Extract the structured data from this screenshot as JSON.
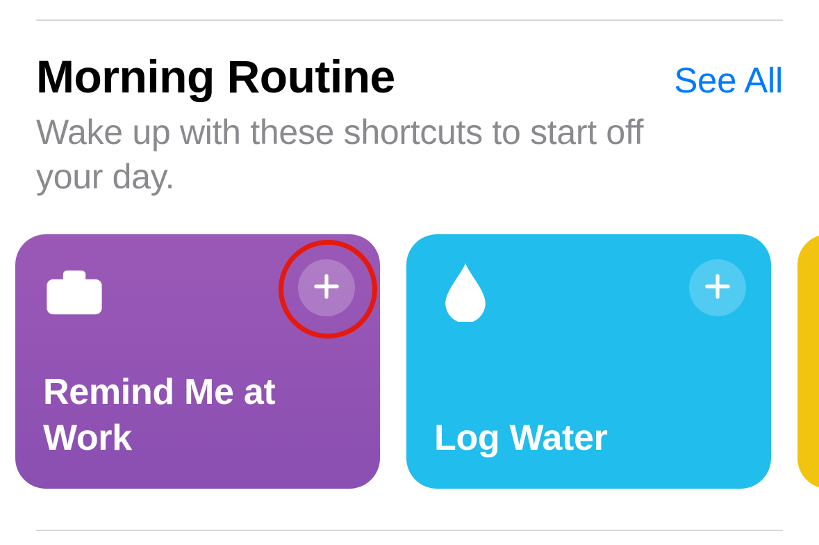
{
  "section": {
    "title": "Morning Routine",
    "subtitle": "Wake up with these shortcuts to start off your day.",
    "see_all": "See All"
  },
  "cards": [
    {
      "title": "Remind Me at Work",
      "icon": "briefcase-icon",
      "color": "purple"
    },
    {
      "title": "Log Water",
      "icon": "water-drop-icon",
      "color": "blue"
    },
    {
      "title": "",
      "icon": "",
      "color": "yellow"
    }
  ]
}
